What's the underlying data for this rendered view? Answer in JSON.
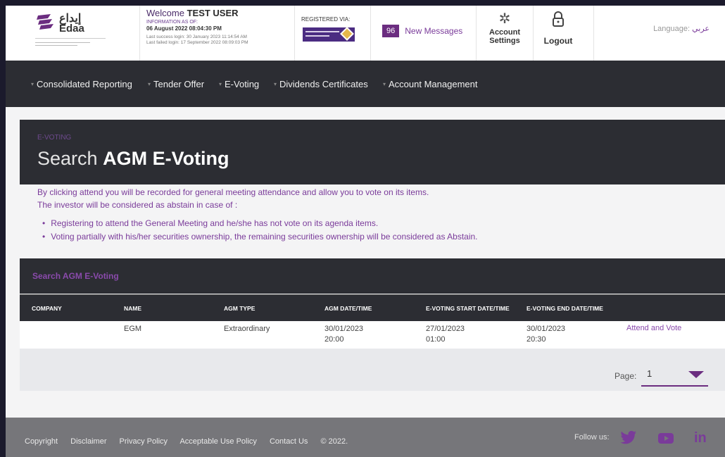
{
  "header": {
    "logo_ar": "إيداع",
    "logo_en": "Edaa",
    "welcome_prefix": "Welcome",
    "user_name": "TEST USER",
    "info_label": "INFORMATION AS OF:",
    "info_date": "06 August 2022 08:04:30 PM",
    "last_success": "Last success login: 30 January 2023 11:14:54 AM",
    "last_failed": "Last failed login: 17 September 2022 08:09:03 PM",
    "registered_via": "REGISTERED VIA:",
    "message_count": "96",
    "messages_label": "New Messages",
    "account_settings_l1": "Account",
    "account_settings_l2": "Settings",
    "logout_label": "Logout",
    "language_label": "Language:",
    "language_value": "عربي"
  },
  "nav": {
    "items": [
      {
        "label": "Consolidated Reporting"
      },
      {
        "label": "Tender Offer"
      },
      {
        "label": "E-Voting"
      },
      {
        "label": "Dividends Certificates"
      },
      {
        "label": "Account Management"
      }
    ]
  },
  "hero": {
    "breadcrumb": "E-VOTING",
    "title_light": "Search",
    "title_bold": "AGM E-Voting"
  },
  "intro": {
    "line1": "By clicking attend you will be recorded for general meeting attendance and allow you to vote on its items.",
    "line2": "The investor will be considered as abstain in case of :",
    "bullets": [
      "Registering to attend the General Meeting and he/she has not vote on its agenda items.",
      "Voting partially with his/her securities ownership, the remaining securities ownership will be considered as Abstain."
    ]
  },
  "table": {
    "title": "Search AGM E-Voting",
    "columns": [
      "COMPANY",
      "NAME",
      "AGM TYPE",
      "AGM DATE/TIME",
      "E-VOTING START DATE/TIME",
      "E-VOTING END DATE/TIME"
    ],
    "rows": [
      {
        "company": "",
        "name": "EGM",
        "agm_type": "Extraordinary",
        "agm_date": "30/01/2023",
        "agm_time": "20:00",
        "start_date": "27/01/2023",
        "start_time": "01:00",
        "end_date": "30/01/2023",
        "end_time": "20:30",
        "action": "Attend and Vote"
      }
    ],
    "page_label": "Page:",
    "page_value": "1"
  },
  "footer": {
    "links": [
      "Copyright",
      "Disclaimer",
      "Privacy Policy",
      "Acceptable Use Policy",
      "Contact Us",
      "© 2022."
    ],
    "follow_label": "Follow us:",
    "social": [
      "twitter-icon",
      "youtube-icon",
      "linkedin-icon"
    ]
  },
  "colors": {
    "accent": "#7a3b9a",
    "dark_bar": "#2c2d33",
    "footer": "#76767a"
  }
}
